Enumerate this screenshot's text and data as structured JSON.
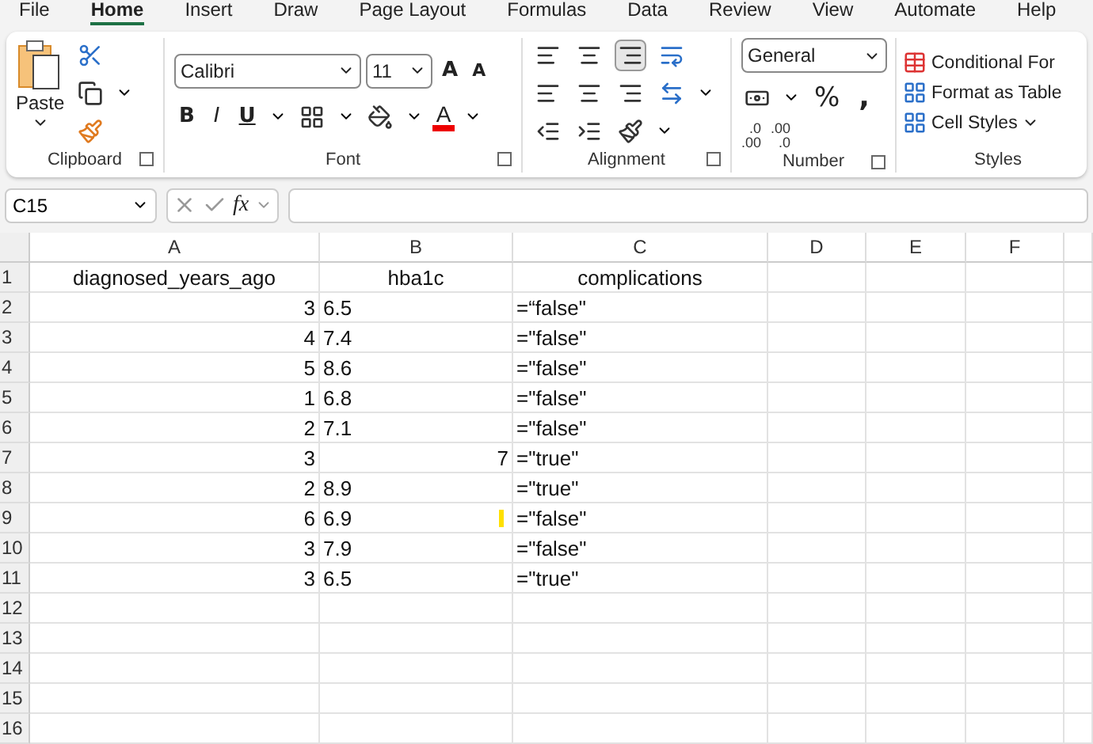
{
  "menu_tabs": [
    {
      "label": "File",
      "selected": false
    },
    {
      "label": "Home",
      "selected": true
    },
    {
      "label": "Insert",
      "selected": false
    },
    {
      "label": "Draw",
      "selected": false
    },
    {
      "label": "Page Layout",
      "selected": false
    },
    {
      "label": "Formulas",
      "selected": false
    },
    {
      "label": "Data",
      "selected": false
    },
    {
      "label": "Review",
      "selected": false
    },
    {
      "label": "View",
      "selected": false
    },
    {
      "label": "Automate",
      "selected": false
    },
    {
      "label": "Help",
      "selected": false
    }
  ],
  "ribbon": {
    "clipboard": {
      "paste": "Paste",
      "label": "Clipboard"
    },
    "font": {
      "name": "Calibri",
      "size": "11",
      "grow": "A",
      "shrink": "A",
      "bold": "B",
      "italic": "I",
      "underline": "U",
      "font_color": "A",
      "label": "Font"
    },
    "alignment": {
      "label": "Alignment",
      "bottom_align_selected": true
    },
    "number": {
      "format": "General",
      "percent": "%",
      "comma": ",",
      "increase_decimal": [
        ".0",
        ".00"
      ],
      "decrease_decimal": [
        ".00",
        ".0"
      ],
      "label": "Number"
    },
    "styles": {
      "items": [
        "Conditional For",
        "Format as Table",
        "Cell Styles"
      ],
      "label": "Styles"
    }
  },
  "formula_bar": {
    "name_box": "C15",
    "fx": "fx"
  },
  "sheet": {
    "columns": [
      "A",
      "B",
      "C",
      "D",
      "E",
      "F"
    ],
    "rows": [
      {
        "label": "1",
        "flagged": false,
        "cells": [
          {
            "text": "diagnosed_years_ago",
            "kind": "header"
          },
          {
            "text": "hba1c",
            "kind": "header"
          },
          {
            "text": "complications",
            "kind": "header"
          }
        ]
      },
      {
        "label": "2",
        "flagged": false,
        "cells": [
          {
            "text": "3",
            "kind": "number"
          },
          {
            "text": "6.5",
            "kind": "text"
          },
          {
            "text": "=“false\"",
            "kind": "text"
          }
        ]
      },
      {
        "label": "3",
        "flagged": false,
        "cells": [
          {
            "text": "4",
            "kind": "number"
          },
          {
            "text": "7.4",
            "kind": "text"
          },
          {
            "text": "=\"false\"",
            "kind": "text"
          }
        ]
      },
      {
        "label": "4",
        "flagged": false,
        "cells": [
          {
            "text": "5",
            "kind": "number"
          },
          {
            "text": "8.6",
            "kind": "text"
          },
          {
            "text": "=\"false\"",
            "kind": "text"
          }
        ]
      },
      {
        "label": "5",
        "flagged": false,
        "cells": [
          {
            "text": "1",
            "kind": "number"
          },
          {
            "text": "6.8",
            "kind": "text"
          },
          {
            "text": "=\"false\"",
            "kind": "text"
          }
        ]
      },
      {
        "label": "6",
        "flagged": false,
        "cells": [
          {
            "text": "2",
            "kind": "number"
          },
          {
            "text": "7.1",
            "kind": "text"
          },
          {
            "text": "=\"false\"",
            "kind": "text"
          }
        ]
      },
      {
        "label": "7",
        "flagged": false,
        "cells": [
          {
            "text": "3",
            "kind": "number"
          },
          {
            "text": "7",
            "kind": "number"
          },
          {
            "text": "=\"true\"",
            "kind": "text"
          }
        ]
      },
      {
        "label": "8",
        "flagged": false,
        "cells": [
          {
            "text": "2",
            "kind": "number"
          },
          {
            "text": "8.9",
            "kind": "text"
          },
          {
            "text": "=\"true\"",
            "kind": "text"
          }
        ]
      },
      {
        "label": "9",
        "flagged": true,
        "cells": [
          {
            "text": "6",
            "kind": "number"
          },
          {
            "text": "6.9",
            "kind": "text"
          },
          {
            "text": "=\"false\"",
            "kind": "text"
          }
        ]
      },
      {
        "label": "10",
        "flagged": false,
        "cells": [
          {
            "text": "3",
            "kind": "number"
          },
          {
            "text": "7.9",
            "kind": "text"
          },
          {
            "text": "=\"false\"",
            "kind": "text"
          }
        ]
      },
      {
        "label": "11",
        "flagged": false,
        "cells": [
          {
            "text": "3",
            "kind": "number"
          },
          {
            "text": "6.5",
            "kind": "text"
          },
          {
            "text": "=\"true\"",
            "kind": "text"
          }
        ]
      },
      {
        "label": "12",
        "flagged": false,
        "cells": []
      },
      {
        "label": "13",
        "flagged": false,
        "cells": []
      },
      {
        "label": "14",
        "flagged": false,
        "cells": []
      },
      {
        "label": "15",
        "flagged": false,
        "cells": []
      },
      {
        "label": "16",
        "flagged": false,
        "cells": []
      }
    ]
  }
}
